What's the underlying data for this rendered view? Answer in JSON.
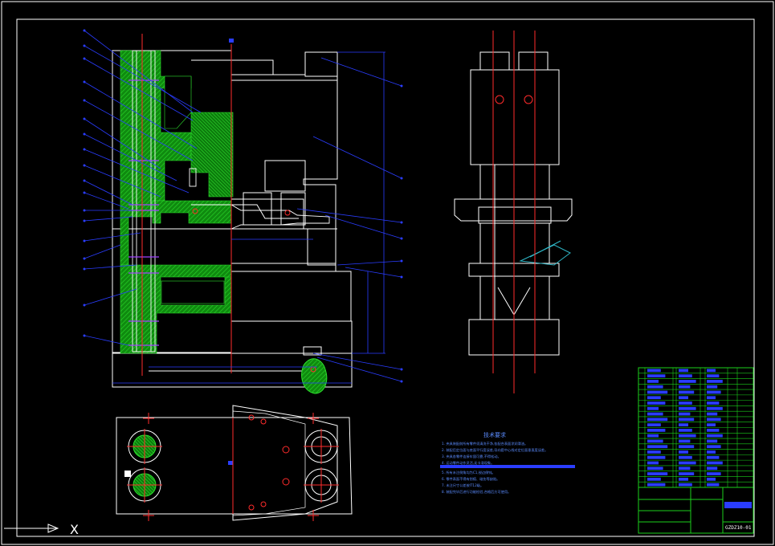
{
  "technical_requirements": {
    "title": "技术要求",
    "lines": [
      "1. 夹具装配前所有零件须清洗干净,各配合表面涂润滑油。",
      "2. 装配后定位面与底面平行度误差,导向套中心线对定位面垂直度误差。",
      "3. 夹具各零件连接牢固可靠,不得松动。",
      "4. 运动零件动作灵活,无卡滞现象。",
      "5. 所有未注倒角均为C1,锐边倒钝。",
      "6. 零件表面不得有划痕、碰伤等缺陷。",
      "7. 未注尺寸公差按IT12级。",
      "8. 装配完毕后进行功能检验,合格后方可使用。"
    ]
  },
  "title_block": {
    "drawing_number": "GZDZ10-01"
  },
  "axis_indicator": {
    "x_label": "X"
  },
  "colors": {
    "background": "#000000",
    "border": "#ffffff",
    "outline": "#ffffff",
    "centerline": "#ff2b2b",
    "leader": "#2a3dff",
    "section_fill": "#1bb81b",
    "table_line": "#1bd01b",
    "note_text": "#5b8cff",
    "highlight": "#8a30ff"
  }
}
